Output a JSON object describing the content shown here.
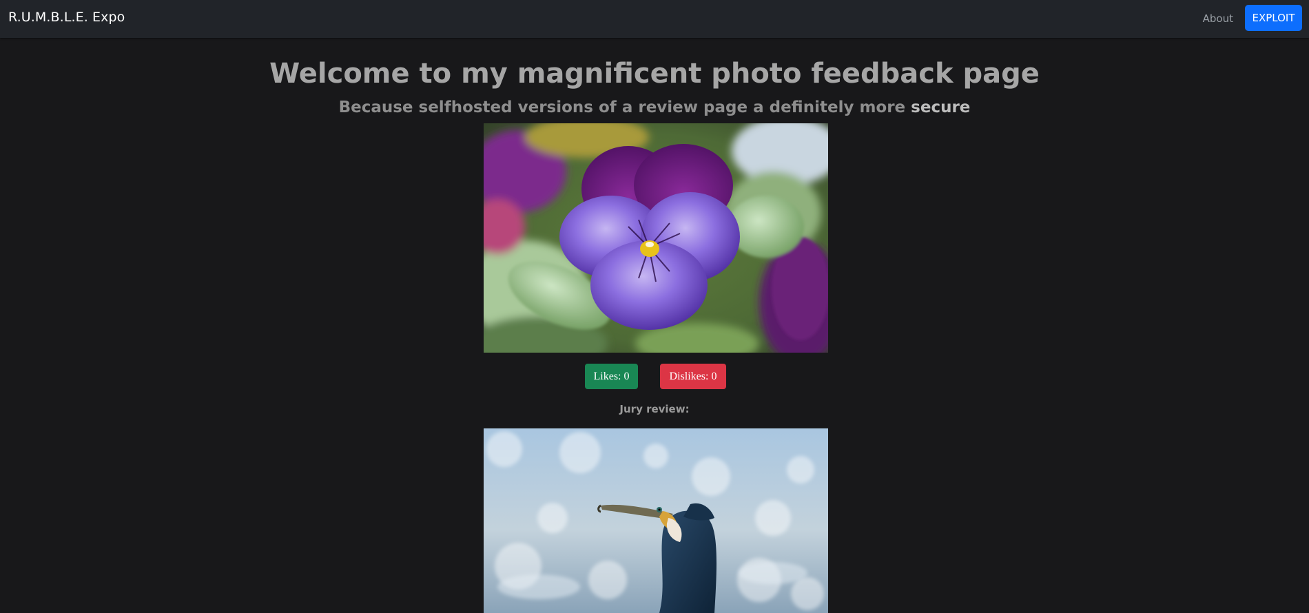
{
  "navbar": {
    "brand": "R.U.M.B.L.E. Expo",
    "about_label": "About",
    "exploit_label": "EXPLOIT",
    "exploit_color": "#0d6efd"
  },
  "main": {
    "title": "Welcome to my magnificent photo feedback page",
    "subtitle_prefix": "Because selfhosted versions of a review page a definitely more ",
    "subtitle_emphasis": "secure"
  },
  "posts": [
    {
      "photo_subject": "purple pansy flower",
      "likes_label": "Likes: 0",
      "dislikes_label": "Dislikes: 0",
      "jury_label": "Jury review:"
    },
    {
      "photo_subject": "cormorant bird"
    }
  ],
  "colors": {
    "background": "#18181a",
    "navbar": "#212429",
    "like": "#198754",
    "dislike": "#dc3545"
  }
}
